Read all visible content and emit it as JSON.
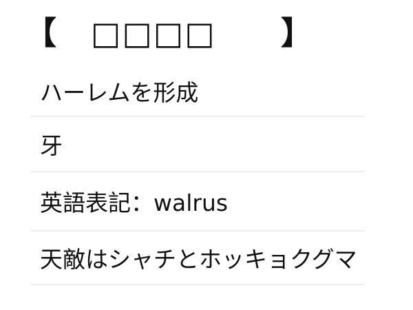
{
  "header": {
    "bracket_open": "【",
    "title": "□□□□",
    "bracket_close": "】"
  },
  "items": [
    {
      "text": "ハーレムを形成"
    },
    {
      "text": "牙"
    },
    {
      "text": "英語表記：walrus"
    },
    {
      "text": "天敵はシャチとホッキョクグマ"
    }
  ]
}
